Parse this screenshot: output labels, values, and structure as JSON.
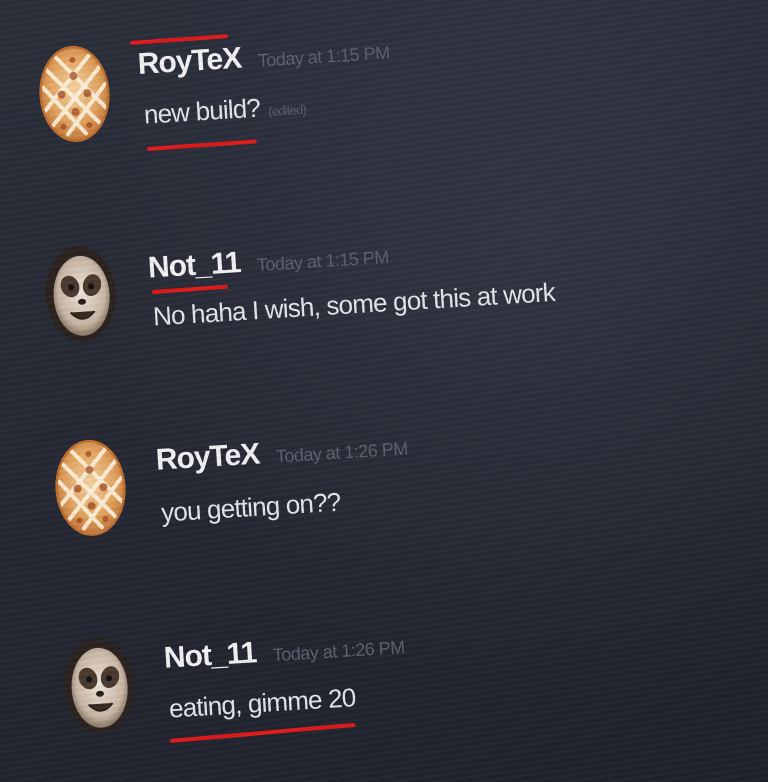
{
  "messages": [
    {
      "author": "RoyTeX",
      "time": "Today at 1:15 PM",
      "text": "new build?",
      "edited": "(edited)",
      "avatar_icon": "pie-icon"
    },
    {
      "author": "Not_11",
      "time": "Today at 1:15 PM",
      "text": "No haha I wish, some got this at work",
      "avatar_icon": "sloth-icon"
    },
    {
      "author": "RoyTeX",
      "time": "Today at 1:26 PM",
      "text": "you getting on??",
      "avatar_icon": "pie-icon"
    },
    {
      "author": "Not_11",
      "time": "Today at 1:26 PM",
      "text": "eating, gimme 20",
      "avatar_icon": "sloth-icon"
    }
  ],
  "colors": {
    "background": "#262934",
    "author": "#f2f2f5",
    "timestamp": "#5d6170",
    "message": "#e4e5ea",
    "annotation_underline": "#e01b1b"
  }
}
